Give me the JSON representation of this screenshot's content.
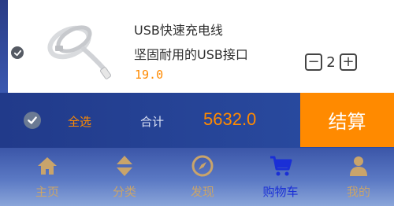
{
  "product": {
    "name": "USB快速充电线",
    "description": "坚固耐用的USB接口",
    "price": "19.0",
    "quantity": "2",
    "image_icon": "usb-cable-image",
    "decrement_symbol": "−",
    "increment_symbol": "+"
  },
  "checkout": {
    "select_all_label": "全选",
    "total_label": "合计",
    "total_value": "5632.0",
    "button_label": "结算"
  },
  "nav": {
    "items": [
      {
        "label": "主页",
        "icon": "home-icon"
      },
      {
        "label": "分类",
        "icon": "sort-icon"
      },
      {
        "label": "发现",
        "icon": "compass-icon"
      },
      {
        "label": "购物车",
        "icon": "cart-icon",
        "active": true
      },
      {
        "label": "我的",
        "icon": "user-icon"
      }
    ]
  },
  "colors": {
    "accent": "#ff8a00",
    "active_nav": "#1a2fd6",
    "nav_label": "#c9a46b"
  }
}
